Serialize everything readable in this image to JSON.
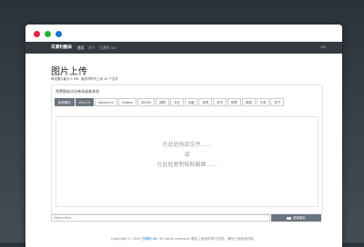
{
  "colors": {
    "background": "#343a40",
    "navbar": "#343a40",
    "traffic_red": "#e2234a",
    "traffic_green": "#27b43e",
    "traffic_blue": "#1e73cf",
    "button_dark": "#6c757d",
    "link": "#1e73cf"
  },
  "navbar": {
    "brand": "日源利图床",
    "links": [
      {
        "label": "首页",
        "active": true
      },
      {
        "label": "关于",
        "active": false
      },
      {
        "label": "日源利 Git",
        "active": false
      }
    ],
    "right_label": "API"
  },
  "page": {
    "title": "图片上传",
    "subtitle": "单张图片最大 5 MB，最多同时可上传 10 个文件"
  },
  "uploader": {
    "header": "免费图床点击单选或者多选",
    "hosts": [
      {
        "label": "新浪图床",
        "active": true
      },
      {
        "label": "Vim-Cn",
        "active": true
      },
      {
        "label": "Upload.Cc",
        "active": false
      },
      {
        "label": "Catbox",
        "active": false
      },
      {
        "label": "SM.MS",
        "active": false
      },
      {
        "label": "搜狗",
        "active": false
      },
      {
        "label": "今日",
        "active": false
      },
      {
        "label": "百度",
        "active": false
      },
      {
        "label": "奇虎",
        "active": false
      },
      {
        "label": "京东",
        "active": false
      },
      {
        "label": "阿里",
        "active": false
      },
      {
        "label": "网易",
        "active": false
      },
      {
        "label": "头条",
        "active": false
      },
      {
        "label": "苏宁",
        "active": false
      }
    ],
    "dropzone": {
      "line1": "在此处拖放文件……",
      "line2": "或",
      "line3": "在此处复制粘贴截图……"
    }
  },
  "file_input": {
    "placeholder": "Select files...",
    "button_label": "选择图片",
    "button_icon": "folder-icon"
  },
  "footer": {
    "prefix": "Copyright © 2019",
    "link": "日源利 Git",
    "suffix": ". All rights reserved. 图片上传仅供学习交流，请勿上传违法内容。"
  }
}
